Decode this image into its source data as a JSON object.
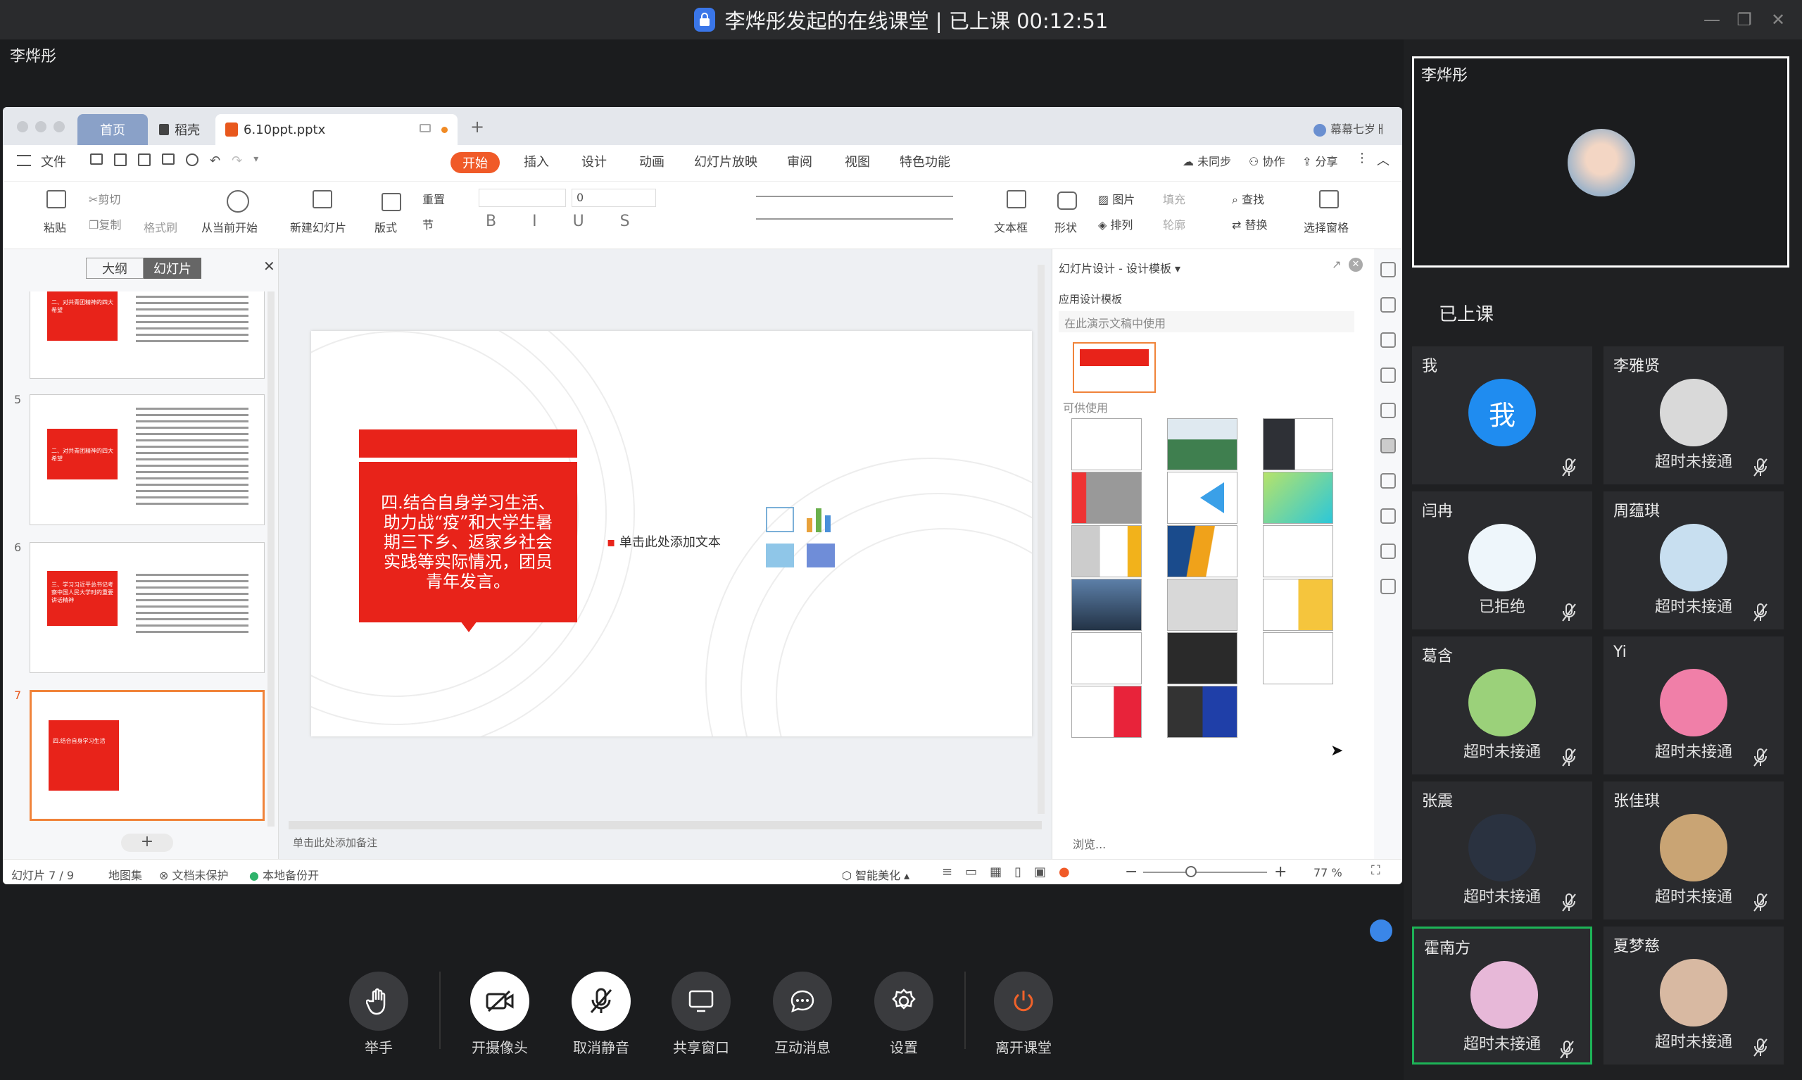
{
  "window": {
    "title": "李烨彤发起的在线课堂 | 已上课 00:12:51"
  },
  "presenter": {
    "name": "李烨彤"
  },
  "ppt": {
    "tabs": {
      "home": "首页",
      "daoke": "稻壳",
      "file": "6.10ppt.pptx",
      "add": "+"
    },
    "user": "幕幕七岁ㅐ",
    "menu": {
      "file": "文件",
      "start": "开始",
      "insert": "插入",
      "design": "设计",
      "animation": "动画",
      "slideshow": "幻灯片放映",
      "review": "审阅",
      "view": "视图",
      "special": "特色功能",
      "unsynced": "未同步",
      "collab": "协作",
      "share": "分享"
    },
    "ribbon": {
      "paste": "粘贴",
      "cut": "剪切",
      "copy": "复制",
      "format_painter": "格式刷",
      "play_from_current": "从当前开始",
      "new_slide": "新建幻灯片",
      "layout": "版式",
      "reset": "重置",
      "section": "节",
      "font_size": "0",
      "textbox": "文本框",
      "shape": "形状",
      "picture": "图片",
      "arrange": "排列",
      "fill": "填充",
      "outline": "轮廓",
      "find": "查找",
      "replace": "替换",
      "select_pane": "选择窗格"
    },
    "thumb_tabs": {
      "outline": "大纲",
      "slides": "幻灯片"
    },
    "thumbnails": [
      {
        "num": "",
        "title": "二、对共青团精神的四大希望"
      },
      {
        "num": "5",
        "title": "二、对共青团精神的四大希望"
      },
      {
        "num": "6",
        "title": "三、学习习近平总书记考察中国人民大学时的重要讲话精神"
      },
      {
        "num": "7",
        "title": "四.结合自身学习生活"
      }
    ],
    "slide": {
      "red_text": "四.结合自身学习生活、助力战“疫”和大学生暑期三下乡、返家乡社会实践等实际情况，团员青年发言。",
      "bullet_placeholder": "单击此处添加文本"
    },
    "notes_placeholder": "单击此处添加备注",
    "design_pane": {
      "title": "幻灯片设计 - 设计模板",
      "applied_label": "应用设计模板",
      "in_doc_label": "在此演示文稿中使用",
      "available_label": "可供使用",
      "browse": "浏览..."
    },
    "status": {
      "slide_counter": "幻灯片 7 / 9",
      "atlas": "地图集",
      "protect": "文档未保护",
      "backup": "本地备份开",
      "beautify": "智能美化",
      "zoom": "77 %"
    }
  },
  "sidebar": {
    "main_name": "李烨彤",
    "section_label": "已上课",
    "participants": [
      {
        "name": "我",
        "status": "",
        "avatar_text": "我",
        "color": "#1f8cf0"
      },
      {
        "name": "李雅贤",
        "status": "超时未接通",
        "color": "#d9d9d9"
      },
      {
        "name": "闫冉",
        "status": "已拒绝",
        "color": "#eef6fb"
      },
      {
        "name": "周蕴琪",
        "status": "超时未接通",
        "color": "#c8dff0"
      },
      {
        "name": "葛含",
        "status": "超时未接通",
        "color": "#9bd17a"
      },
      {
        "name": "Yi",
        "status": "超时未接通",
        "color": "#f07fa8"
      },
      {
        "name": "张震",
        "status": "超时未接通",
        "color": "#2a3240"
      },
      {
        "name": "张佳琪",
        "status": "超时未接通",
        "color": "#c9a474"
      },
      {
        "name": "霍南方",
        "status": "超时未接通",
        "color": "#e7b8d8"
      },
      {
        "name": "夏梦慈",
        "status": "超时未接通",
        "color": "#d8b9a2"
      }
    ]
  },
  "toolbar": {
    "raise_hand": "举手",
    "camera": "开摄像头",
    "unmute": "取消静音",
    "share_window": "共享窗口",
    "messages": "互动消息",
    "settings": "设置",
    "leave": "离开课堂"
  }
}
